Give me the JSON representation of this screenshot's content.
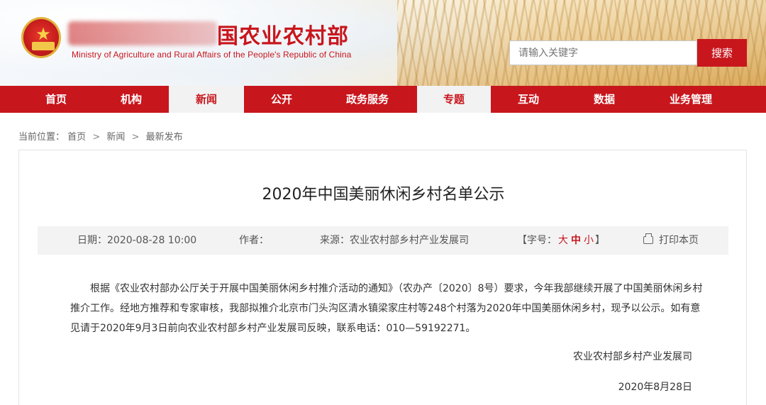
{
  "header": {
    "site_title": "国农业农村部",
    "site_subtitle": "Ministry of Agriculture and Rural Affairs of the People's Republic of China",
    "search_placeholder": "请输入关键字",
    "search_button": "搜索"
  },
  "nav": {
    "items": [
      {
        "label": "首页",
        "active": false
      },
      {
        "label": "机构",
        "active": false
      },
      {
        "label": "新闻",
        "active": true
      },
      {
        "label": "公开",
        "active": false
      },
      {
        "label": "政务服务",
        "active": false
      },
      {
        "label": "专题",
        "active": true
      },
      {
        "label": "互动",
        "active": false
      },
      {
        "label": "数据",
        "active": false
      },
      {
        "label": "业务管理",
        "active": false
      }
    ]
  },
  "breadcrumb": {
    "prefix": "当前位置：",
    "items": [
      "首页",
      "新闻",
      "最新发布"
    ],
    "separator": ">"
  },
  "article": {
    "title": "2020年中国美丽休闲乡村名单公示",
    "date_label": "日期：2020-08-28 10:00",
    "author_label": "作者：",
    "source_label": "来源：农业农村部乡村产业发展司",
    "font_size_prefix": "【字号：",
    "font_size_large": "大",
    "font_size_medium": "中",
    "font_size_small": "小",
    "font_size_suffix": "】",
    "print_label": "打印本页",
    "body": "根据《农业农村部办公厅关于开展中国美丽休闲乡村推介活动的通知》（农办产〔2020〕8号）要求，今年我部继续开展了中国美丽休闲乡村推介工作。经地方推荐和专家审核，我部拟推介北京市门头沟区清水镇梁家庄村等248个村落为2020年中国美丽休闲乡村，现予以公示。如有意见请于2020年9月3日前向农业农村部乡村产业发展司反映，联系电话：010—59192271。",
    "signature": "农业农村部乡村产业发展司",
    "signature_date": "2020年8月28日"
  },
  "colors": {
    "brand_red": "#c8161d",
    "meta_bg": "#f3f3f3",
    "nav_active_bg": "#f2f2f2"
  }
}
